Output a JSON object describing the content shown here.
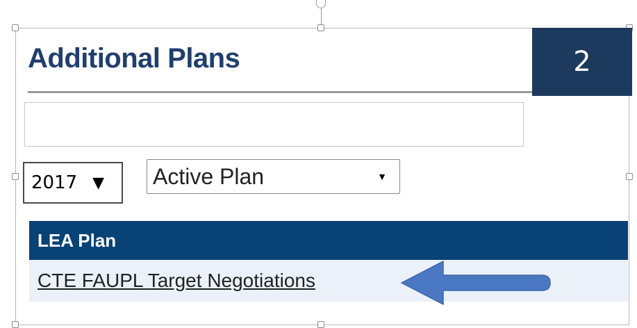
{
  "panel": {
    "title": "Additional Plans",
    "badge_number": "2"
  },
  "filters": {
    "year_value": "2017",
    "year_arrow": "▼",
    "plan_value": "Active Plan",
    "plan_arrow": "▼"
  },
  "table": {
    "header": "LEA Plan",
    "rows": [
      {
        "link": "CTE FAUPL Target Negotiations"
      }
    ]
  },
  "annotation": {
    "arrow_color": "#4a78c2"
  }
}
